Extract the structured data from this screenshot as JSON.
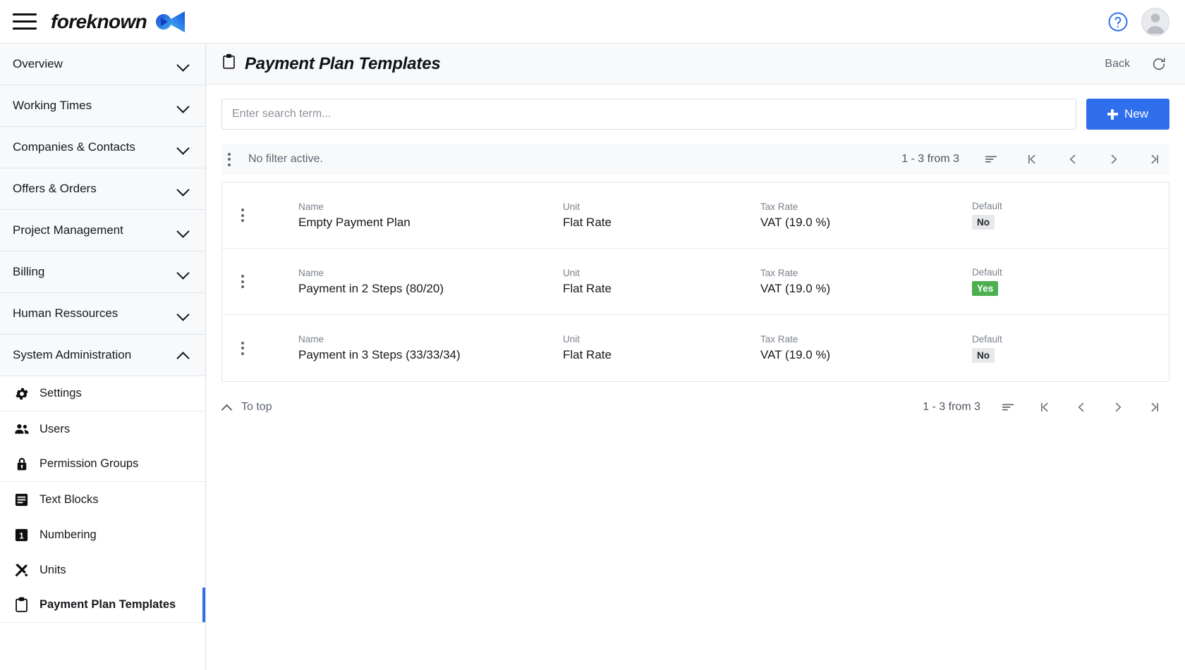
{
  "topbar": {
    "menu_icon": "hamburger-menu-icon",
    "brand_name": "foreknown",
    "brand_logo_icon": "foreknown-logo-icon",
    "help_icon": "help-circle-icon",
    "avatar_icon": "user-avatar-icon",
    "accent_color": "#2f6fed"
  },
  "sidebar": {
    "groups": [
      {
        "label": "Overview",
        "expanded": false
      },
      {
        "label": "Working Times",
        "expanded": false
      },
      {
        "label": "Companies & Contacts",
        "expanded": false
      },
      {
        "label": "Offers & Orders",
        "expanded": false
      },
      {
        "label": "Project Management",
        "expanded": false
      },
      {
        "label": "Billing",
        "expanded": false
      },
      {
        "label": "Human Ressources",
        "expanded": false
      },
      {
        "label": "System Administration",
        "expanded": true
      }
    ],
    "items": [
      {
        "label": "Settings",
        "icon": "gear-icon",
        "active": false
      },
      {
        "label": "Users",
        "icon": "people-icon",
        "active": false
      },
      {
        "label": "Permission Groups",
        "icon": "lock-icon",
        "active": false
      },
      {
        "label": "Text Blocks",
        "icon": "text-block-icon",
        "active": false
      },
      {
        "label": "Numbering",
        "icon": "number-one-icon",
        "active": false
      },
      {
        "label": "Units",
        "icon": "tools-icon",
        "active": false
      },
      {
        "label": "Payment Plan Templates",
        "icon": "clipboard-icon",
        "active": true
      }
    ]
  },
  "page": {
    "title": "Payment Plan Templates",
    "title_icon": "clipboard-icon",
    "back_label": "Back",
    "refresh_icon": "refresh-icon"
  },
  "search": {
    "value": "",
    "placeholder": "Enter search term...",
    "new_label": "New",
    "new_icon": "plus-icon"
  },
  "toolbar": {
    "menu_icon": "kebab-menu-icon",
    "filter_text": "No filter active.",
    "count_text": "1 - 3 from 3",
    "sort_icon": "sort-icon",
    "first_icon": "first-page-icon",
    "prev_icon": "previous-page-icon",
    "next_icon": "next-page-icon",
    "last_icon": "last-page-icon"
  },
  "table": {
    "columns": [
      "Name",
      "Unit",
      "Tax Rate",
      "Default"
    ],
    "rows": [
      {
        "name_header": "Name",
        "name": "Empty Payment Plan",
        "unit_header": "Unit",
        "unit": "Flat Rate",
        "tax_header": "Tax Rate",
        "tax": "VAT (19.0 %)",
        "default_header": "Default",
        "default": "No",
        "default_state": "no"
      },
      {
        "name_header": "Name",
        "name": "Payment in 2 Steps (80/20)",
        "unit_header": "Unit",
        "unit": "Flat Rate",
        "tax_header": "Tax Rate",
        "tax": "VAT (19.0 %)",
        "default_header": "Default",
        "default": "Yes",
        "default_state": "yes"
      },
      {
        "name_header": "Name",
        "name": "Payment in 3 Steps (33/33/34)",
        "unit_header": "Unit",
        "unit": "Flat Rate",
        "tax_header": "Tax Rate",
        "tax": "VAT (19.0 %)",
        "default_header": "Default",
        "default": "No",
        "default_state": "no"
      }
    ]
  },
  "footer": {
    "to_top_label": "To top",
    "to_top_icon": "caret-up-icon",
    "count_text": "1 - 3 from 3"
  },
  "colors": {
    "badge_yes": "#4caf50",
    "badge_no": "#e6e8eb",
    "active_marker": "#2f6fed"
  }
}
